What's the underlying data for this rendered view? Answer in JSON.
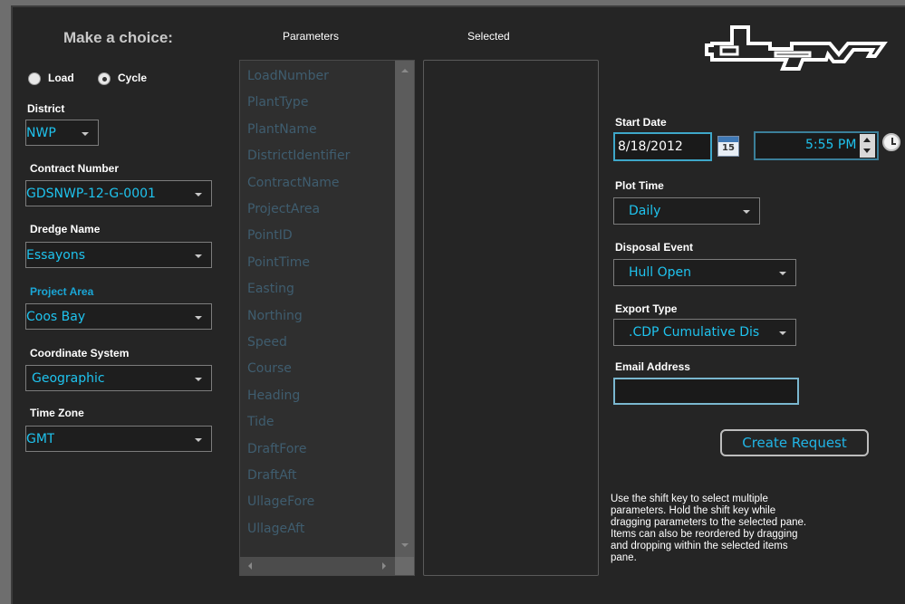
{
  "header": {
    "title": "Make a choice:",
    "parameters_heading": "Parameters",
    "selected_heading": "Selected",
    "logo_text": "dqm"
  },
  "mode": {
    "options": [
      {
        "label": "Load",
        "checked": false
      },
      {
        "label": "Cycle",
        "checked": true
      }
    ]
  },
  "fields": {
    "district": {
      "label": "District",
      "value": "NWP"
    },
    "contract_number": {
      "label": "Contract Number",
      "value": "GDSNWP-12-G-0001"
    },
    "dredge_name": {
      "label": "Dredge Name",
      "value": "Essayons"
    },
    "project_area": {
      "label": "Project Area",
      "value": "Coos Bay"
    },
    "coordinate_system": {
      "label": "Coordinate System",
      "value": "Geographic"
    },
    "time_zone": {
      "label": "Time Zone",
      "value": "GMT"
    }
  },
  "parameters": [
    "LoadNumber",
    "PlantType",
    "PlantName",
    "DistrictIdentifier",
    "ContractName",
    "ProjectArea",
    "PointID",
    "PointTime",
    "Easting",
    "Northing",
    "Speed",
    "Course",
    "Heading",
    "Tide",
    "DraftFore",
    "DraftAft",
    "UllageFore",
    "UllageAft"
  ],
  "right": {
    "start_date_label": "Start Date",
    "start_date_value": "8/18/2012",
    "calendar_day": "15",
    "time_value": "5:55 PM",
    "plot_time_label": "Plot Time",
    "plot_time_value": "Daily",
    "disposal_event_label": "Disposal Event",
    "disposal_event_value": "Hull Open",
    "export_type_label": "Export Type",
    "export_type_value": ".CDP Cumulative Dis",
    "email_label": "Email Address",
    "email_value": "",
    "create_button": "Create Request",
    "help_text": "Use the shift key to select multiple parameters. Hold the shift key while dragging parameters to the selected pane. Items can also be reordered by dragging and dropping within the selected items pane."
  },
  "colors": {
    "accent": "#1fc3ee",
    "background": "#252525",
    "muted_list_text": "#3f5d6f"
  }
}
